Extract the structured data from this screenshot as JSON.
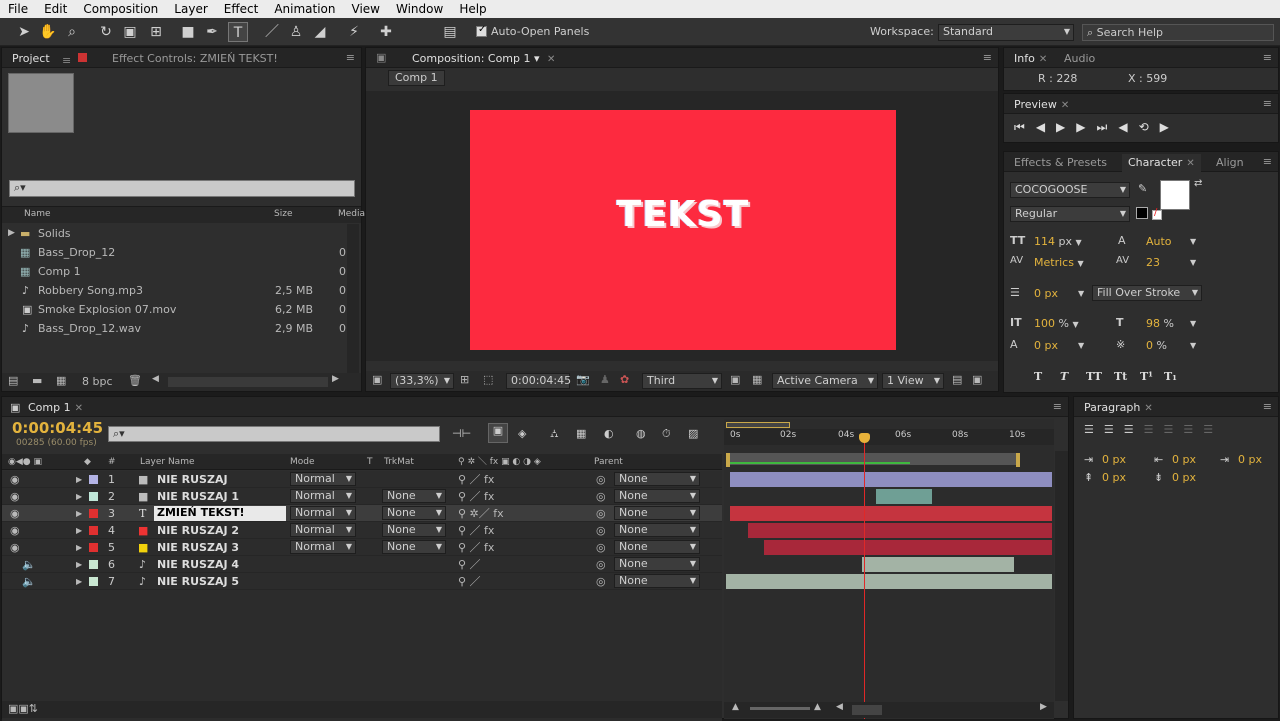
{
  "menu": [
    "File",
    "Edit",
    "Composition",
    "Layer",
    "Effect",
    "Animation",
    "View",
    "Window",
    "Help"
  ],
  "toolbar": {
    "auto_open": "Auto-Open Panels",
    "workspace_label": "Workspace:",
    "workspace_value": "Standard",
    "search_placeholder": "Search Help"
  },
  "project": {
    "tab": "Project",
    "effect_tab": "Effect Controls: ZMIEŃ TEKST!",
    "col_name": "Name",
    "col_size": "Size",
    "col_media": "Media",
    "bpc": "8 bpc",
    "items": [
      {
        "name": "Solids",
        "size": "",
        "icon": "folder-icon",
        "extra": ""
      },
      {
        "name": "Bass_Drop_12",
        "size": "",
        "icon": "composition-icon",
        "extra": "0"
      },
      {
        "name": "Comp 1",
        "size": "",
        "icon": "composition-icon",
        "extra": "0"
      },
      {
        "name": "Robbery Song.mp3",
        "size": "2,5 MB",
        "icon": "audio-file-icon",
        "extra": "0"
      },
      {
        "name": "Smoke Explosion 07.mov",
        "size": "6,2 MB",
        "icon": "video-file-icon",
        "extra": "0"
      },
      {
        "name": "Bass_Drop_12.wav",
        "size": "2,9 MB",
        "icon": "audio-file-icon",
        "extra": "0"
      }
    ]
  },
  "composition": {
    "tab": "Composition: Comp 1",
    "subtab": "Comp 1",
    "canvas_text": "TEKST",
    "canvas_color": "#fd2a3f",
    "zoom": "(33,3%)",
    "timecode": "0:00:04:45",
    "view_mode": "Third",
    "camera": "Active Camera",
    "views": "1 View"
  },
  "info": {
    "tab": "Info",
    "tab2": "Audio",
    "r": "R : 228",
    "x": "X : 599"
  },
  "preview": {
    "tab": "Preview"
  },
  "character": {
    "tab_effects": "Effects & Presets",
    "tab": "Character",
    "tab_align": "Align",
    "font": "COCOGOOSE",
    "style": "Regular",
    "size": "114",
    "size_unit": "px",
    "leading": "Auto",
    "kerning": "Metrics",
    "tracking": "23",
    "stroke": "0 px",
    "stroke_mode": "Fill Over Stroke",
    "vscale": "100",
    "hscale": "98",
    "pct": "%",
    "baseline": "0 px",
    "tsume": "0",
    "tsume_unit": "%",
    "format_buttons": [
      "T",
      "T",
      "TT",
      "Tt",
      "T¹",
      "T₁"
    ]
  },
  "paragraph": {
    "tab": "Paragraph",
    "indent1": "0 px",
    "indent2": "0 px",
    "indent3": "0 px",
    "space1": "0 px",
    "space2": "0 px"
  },
  "timeline": {
    "tab": "Comp 1",
    "timecode": "0:00:04:45",
    "fps": "00285 (60.00 fps)",
    "headers": {
      "num": "#",
      "layer": "Layer Name",
      "mode": "Mode",
      "t": "T",
      "trkmat": "TrkMat",
      "parent": "Parent"
    },
    "ruler": [
      "0s",
      "02s",
      "04s",
      "06s",
      "08s",
      "10s"
    ],
    "layers": [
      {
        "num": "1",
        "name": "NIE RUSZAJ",
        "color": "#b4b4e6",
        "mode": "Normal",
        "trkmat": "",
        "parent": "None",
        "type": "solid"
      },
      {
        "num": "2",
        "name": "NIE RUSZAJ 1",
        "color": "#bfe6d8",
        "mode": "Normal",
        "trkmat": "None",
        "parent": "None",
        "type": "solid"
      },
      {
        "num": "3",
        "name": "ZMIEŃ TEKST!",
        "color": "#e03030",
        "mode": "Normal",
        "trkmat": "None",
        "parent": "None",
        "type": "text"
      },
      {
        "num": "4",
        "name": "NIE RUSZAJ 2",
        "color": "#e03030",
        "mode": "Normal",
        "trkmat": "None",
        "parent": "None",
        "type": "solid"
      },
      {
        "num": "5",
        "name": "NIE RUSZAJ 3",
        "color": "#f2d20c",
        "mode": "Normal",
        "trkmat": "None",
        "parent": "None",
        "type": "solid"
      },
      {
        "num": "6",
        "name": "NIE RUSZAJ 4",
        "color": "#c8e6d0",
        "mode": "",
        "trkmat": "",
        "parent": "None",
        "type": "audio"
      },
      {
        "num": "7",
        "name": "NIE RUSZAJ 5",
        "color": "#c8e6d0",
        "mode": "",
        "trkmat": "",
        "parent": "None",
        "type": "audio"
      }
    ]
  }
}
